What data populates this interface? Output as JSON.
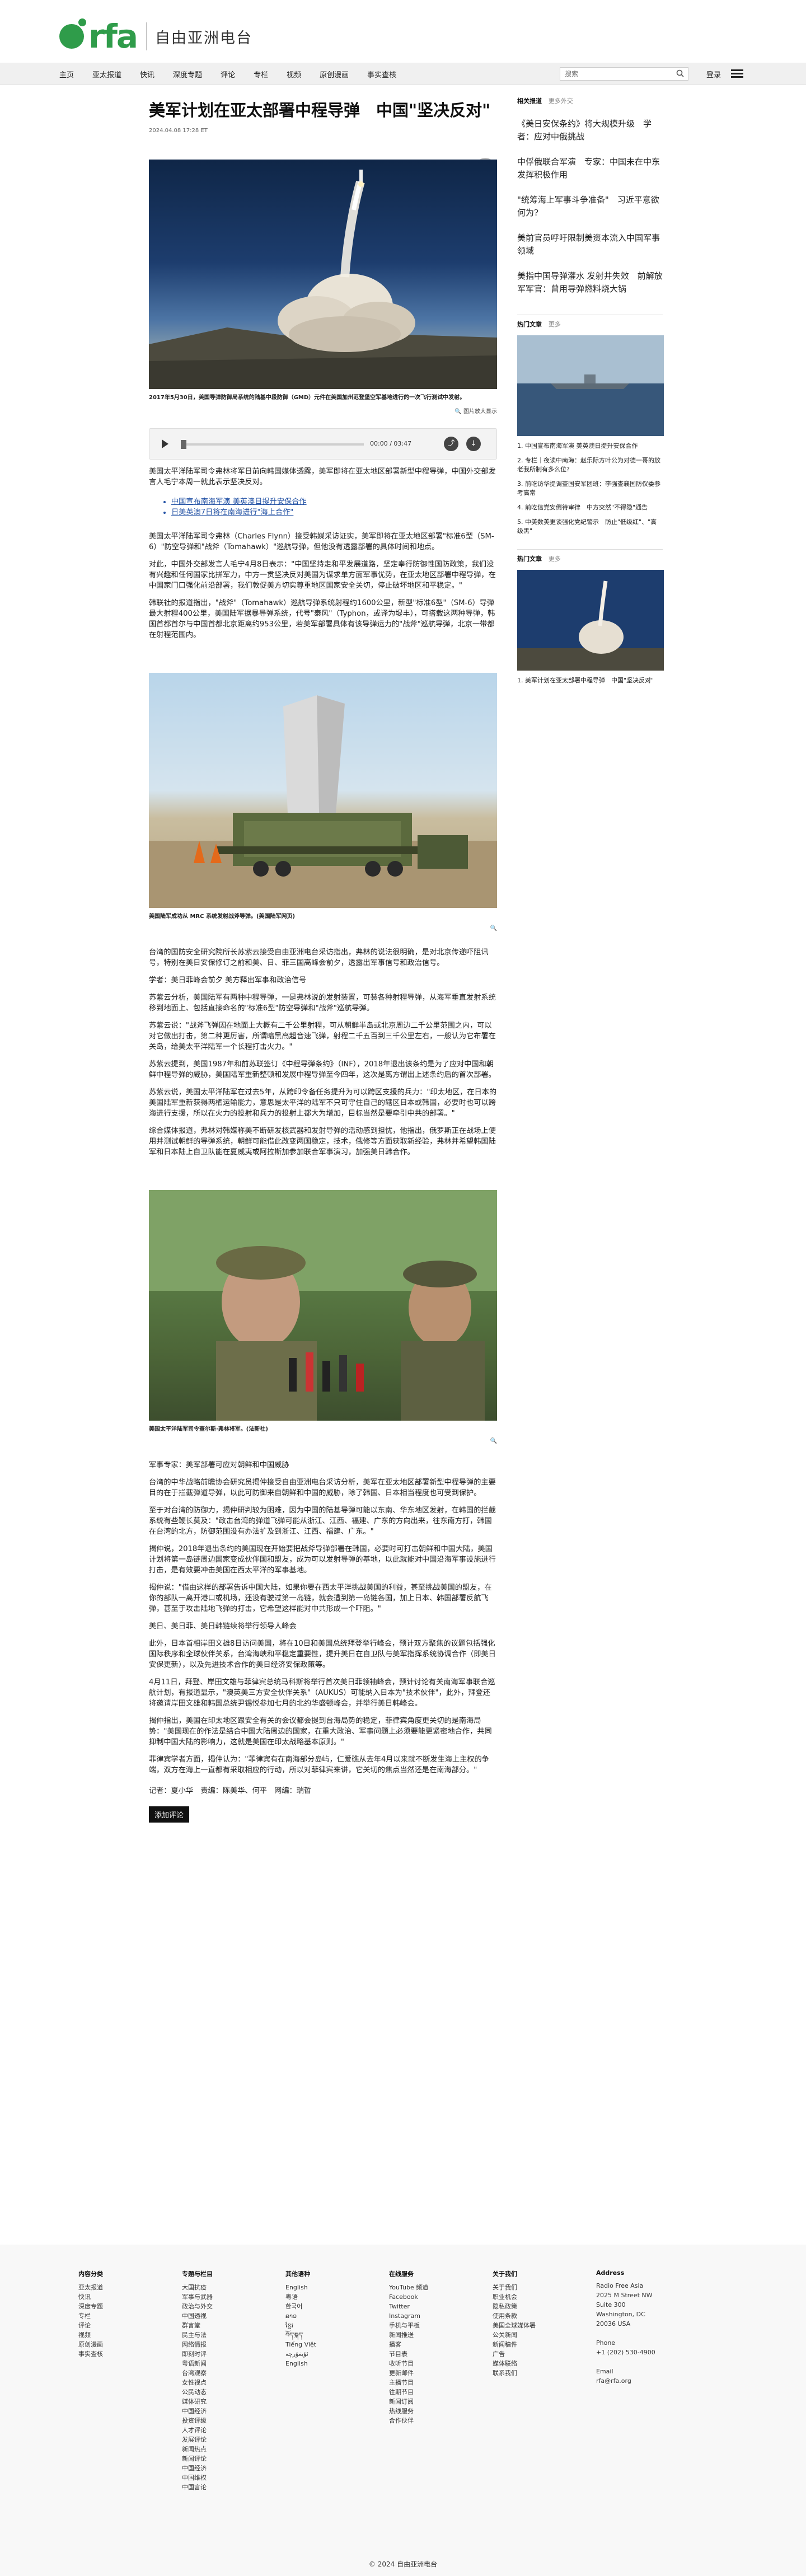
{
  "brand": {
    "logo": "rfa",
    "name_cn": "自由亚洲电台"
  },
  "nav": {
    "items": [
      "主页",
      "亚太报道",
      "快讯",
      "深度专题",
      "评论",
      "专栏",
      "视频",
      "原创漫画",
      "事实查核"
    ],
    "search_placeholder": "搜索",
    "login": "登录"
  },
  "article": {
    "title": "美军计划在亚太部署中程导弹　中国\"坚决反对\"",
    "date": "2024.04.08 17:28 ET",
    "hero_caption": "2017年5月30日，美国导弹防御局系统的陆基中段防御（GMD）元件在美国加州范登堡空军基地进行的一次飞行测试中发射。",
    "enlarge_label": "图片放大显示",
    "player_time": "00:00 / 03:47",
    "p1": "美国太平洋陆军司令弗林将军日前向韩国媒体透露，美军即将在亚太地区部署新型中程导弹，中国外交部发言人毛宁本周一就此表示坚决反对。",
    "links": [
      "中国宣布南海军演 美英澳日提升安保合作",
      "日美英澳7日将在南海进行\"海上合作\""
    ],
    "p2": "美国太平洋陆军司令弗林（Charles Flynn）接受韩媒采访证实，美军即将在亚太地区部署\"标准6型（SM-6）\"防空导弹和\"战斧（Tomahawk）\"巡航导弹，但他没有透露部署的具体时间和地点。",
    "p3": "对此，中国外交部发言人毛宁4月8日表示：\"中国坚持走和平发展道路，坚定奉行防御性国防政策，我们没有兴趣和任何国家比拼军力，中方一贯坚决反对美国为谋求单方面军事优势，在亚太地区部署中程导弹，在中国家门口强化前沿部署，我们敦促美方切实尊重地区国家安全关切，停止破坏地区和平稳定。\"",
    "p4": "韩联社的报道指出，\"战斧\"（Tomahawk）巡航导弹系统射程约1600公里，新型\"标准6型\"（SM-6）导弹最大射程400公里，美国陆军据暴导弹系统，代号\"泰风\"（Typhon，或译为堤丰），可搭载这两种导弹，韩国首都首尔与中国首都北京距离约953公里，若美军部署具体有该导弹运力的\"战斧\"巡航导弹，北京一带都在射程范围内。",
    "image2_caption": "美国陆军成功从 MRC 系统发射战斧导弹。(美国陆军网页)",
    "p5": "台湾的国防安全研究院所长苏紫云接受自由亚洲电台采访指出，弗林的说法很明确，是对北京传递吓阻讯号，特别在美日安保修订之前和美、日、菲三国高峰会前夕，透露出军事信号和政治信号。",
    "p6": "学者：美日菲峰会前夕 美方释出军事和政治信号",
    "p7": "苏紫云分析，美国陆军有两种中程导弹，一是弗林说的发射装置，可装各种射程导弹，从海军垂直发射系统移到地面上、包括直接命名的\"标准6型\"防空导弹和\"战斧\"巡航导弹。",
    "p8": "苏紫云说：\"战斧飞弹因在地面上大概有二千公里射程，可从朝鲜半岛或北京周边二千公里范围之内，可以对它做出打击，第二种更厉害，所谓暗黑高超音速飞弹，射程二千五百到三千公里左右，一般认为它布署在关岛，给美太平洋陆军一个长程打击火力。\"",
    "p9": "苏紫云提到，美国1987年和前苏联签订《中程导弹条约》（INF），2018年退出该条约是为了应对中国和朝鲜中程导弹的威胁，美国陆军重新整顿和发展中程导弹至今四年，这次是离方谓出上述条约后的首次部署。",
    "p10": "苏紫云说，美国太平洋陆军在过去5年，从跨印令备任务提升为可以跨区支援的兵力：\"印太地区，在日本的美国陆军重新获得两栖运输能力，意思是太平洋的陆军不只可守住自己的辖区日本或韩国，必要时也可以跨海进行支援，所以在火力的投射和兵力的投射上都大为增加，目标当然是要牵引中共的部署。\"",
    "p11": "综合媒体报道，弗林对韩媒称美不断研发核武器和发射导弹的活动感到担忧，他指出，俄罗斯正在战场上使用并测试朝鲜的导弹系统，朝鲜可能借此改变两国稳定，技术，俄修等方面获取新经验，弗林并希望韩国陆军和日本陆上自卫队能在夏威夷或阿拉斯加参加联合军事演习，加强美日韩合作。",
    "image3_caption": "美国太平洋陆军司令查尔斯·弗林将军。(法新社)",
    "p12": "军事专家：美军部署可应对朝鲜和中国威胁",
    "p13": "台湾的中华战略前瞻协会研究员揭仲接受自由亚洲电台采访分析，美军在亚太地区部署新型中程导弹的主要目的在于拦截弹道导弹，以此可防御来自朝鲜和中国的威胁，除了韩国、日本相当程度也可受到保护。",
    "p14": "至于对台湾的防御力，揭仲研判较为困难，因为中国的陆基导弹可能以东南、华东地区发射，在韩国的拦截系统有些鞭长莫及：\"政击台湾的弹道飞弹可能从浙江、江西、福建、广东的方向出来，往东南方打，韩国在台湾的北方，防御范围没有办法扩及到浙江、江西、福建、广东。\"",
    "p15": "揭仲说，2018年退出条约的美国现在开始要把战斧导弹部署在韩国，必要时可打击朝鲜和中国大陆，美国计划将第一岛链周边国家变成伙伴国和盟友，成为可以发射导弹的基地，以此就能对中国沿海军事设施进行打击，是有效要冲击美国在西太平洋的军事基地。",
    "p16": "揭仲说：\"借由这样的部署告诉中国大陆，如果你要在西太平洋挑战美国的利益，甚至挑战美国的盟友，在你的部队一离开港口或机场，还没有驶过第一岛链，就会遭到第一岛链各国，加上日本、韩国部署反航飞弹，甚至于攻击陆地飞弹的打击，它希望这样能对中共形成一个吓阻。\"",
    "p17": "美日、美日菲、美日韩链续将举行领导人峰会",
    "p18": "此外，日本首相岸田文雄8日访问美国，将在10日和美国总统拜登举行峰会，预计双方聚焦的议题包括强化国际秩序和全球伙伴关系，台湾海峡和平稳定重要性，提升美日在自卫队与美军指挥系统协调合作（即美日安保更新），以及先进技术合作的美日经济安保政策等。",
    "p19": "4月11日，拜登、岸田文雄与菲律宾总统马科斯将举行首次美日菲领袖峰会，预计讨论有关南海军事联合巡航计划，有报道显示，\"澳英美三方安全伙伴关系\"（AUKUS）可能纳入日本为\"技术伙伴\"，此外，拜登还将邀请岸田文雄和韩国总统尹锡悦参加七月的北约华盛顿峰会，并举行美日韩峰会。",
    "p20": "揭仲指出，美国在印太地区跟安全有关的会议都会提到台海局势的稳定，菲律宾角度更关切的是南海局势：\"美国现在的作法是结合中国大陆周边的国家，在重大政治、军事问题上必须要能更紧密地合作，共同抑制中国大陆的影响力，这就是美国在印太战略基本原则。\"",
    "p21": "菲律宾学者方面，揭仲认为：\"菲律宾有在南海部分岛屿，仁爱礁从去年4月以来就不断发生海上主权的争端，双方在海上一直都有采取相应的行动，所以对菲律宾来讲，它关切的焦点当然还是在南海部分。\"",
    "byline": "记者：夏小华　责编：陈美华、何平　网编：瑞哲",
    "comment_button": "添加评论"
  },
  "sidebar": {
    "related_head": "相关报道",
    "related_more": "更多外交",
    "related": [
      "《美日安保条约》将大规模升级　学者：应对中俄挑战",
      "中俘俄联合军演　专家：中国未在中东发挥积极作用",
      "\"统筹海上军事斗争准备\"　习近平意欲何为?",
      "美前官员呼吁限制美资本流入中国军事领域",
      "美指中国导弹灌水 发射井失效　前解放军军官：曾用导弹燃料烧大锅"
    ],
    "hot_head": "热门文章",
    "hot_more": "更多",
    "hot1": [
      "1. 中国宣布南海军演 美英澳日提升安保合作",
      "2. 专栏｜夜读中南海：赵乐际方叶公为对德一哥的放老我所制有多么位?",
      "3. 前吃访华提调查国安军团班：李强查襄国防仪委参考高常",
      "4. 前吃信党安倒待审律　中方突然\"不得隐\"通告",
      "5. 中美数美更谈强化党纪警示　防止\"低级红\"、\"高级黑\""
    ],
    "hot2": [
      "1. 美军计划在亚太部署中程导弹　中国\"坚决反对\""
    ]
  },
  "footer": {
    "cols": [
      {
        "head": "内容分类",
        "items": [
          "亚太报道",
          "快讯",
          "深度专题",
          "专栏",
          "评论",
          "视频",
          "原创漫画",
          "事实查核"
        ]
      },
      {
        "head": "专题与栏目",
        "items": [
          "大国抗疫",
          "军事与武器",
          "政治与外交",
          "中国透视",
          "群言堂",
          "民主与法",
          "网络情报",
          "即刻时评",
          "粤语新闻",
          "台湾观察",
          "女性视点",
          "公民动态",
          "媒体研究",
          "中国经济",
          "投资评级",
          "人才评论",
          "发展评论",
          "新闻热点",
          "新闻评论",
          "中国经济",
          "中国维权",
          "中国言论"
        ]
      },
      {
        "head": "其他语种",
        "items": [
          "English",
          "粤语",
          "한국어",
          "ລາວ",
          "ខ្មែរ",
          "བོད་སྐད་",
          "Tiếng Việt",
          "ئۇيغۇرچە",
          "English"
        ]
      },
      {
        "head": "在线服务",
        "items": [
          "YouTube 频道",
          "Facebook",
          "Twitter",
          "Instagram",
          "手机与平板",
          "新闻推送",
          "播客",
          "节目表",
          "收听节目",
          "更新邮件",
          "主播节目",
          "往期节目",
          "新闻订阅",
          "热线服务",
          "合作伙伴"
        ]
      },
      {
        "head": "关于我们",
        "items": [
          "关于我们",
          "职业机会",
          "隐私政策",
          "使用条款",
          "美国全球媒体署",
          "公关新闻",
          "新闻稿件",
          "广告",
          "媒体联络",
          "联系我们"
        ]
      },
      {
        "head": "Address",
        "items": [
          "Radio Free Asia",
          "2025 M Street NW",
          "Suite 300",
          "Washington, DC",
          "20036 USA",
          "",
          "Phone",
          "+1 (202) 530-4900",
          "",
          "Email",
          "rfa@rfa.org"
        ]
      }
    ],
    "copyright": "© 2024 自由亚洲电台"
  },
  "colors": {
    "brand_green": "#2f9c4a",
    "link_blue": "#2352a5"
  },
  "icons": [
    "search-icon",
    "hamburger-menu-icon",
    "share-icon",
    "play-icon",
    "zoom-icon",
    "download-icon"
  ]
}
